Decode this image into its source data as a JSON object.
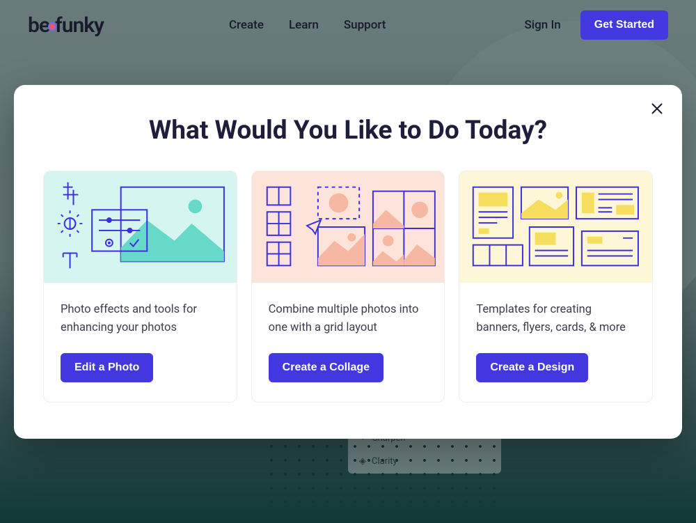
{
  "header": {
    "logo_text_left": "be",
    "logo_text_right": "funky",
    "nav": [
      "Create",
      "Learn",
      "Support"
    ],
    "signin": "Sign In",
    "get_started": "Get Started"
  },
  "bg_panel": {
    "row1": "Sharpen",
    "row2": "Clarity"
  },
  "modal": {
    "title": "What Would You Like to Do Today?",
    "cards": [
      {
        "desc": "Photo effects and tools for enhancing your photos",
        "button": "Edit a Photo"
      },
      {
        "desc": "Combine multiple photos into one with a grid layout",
        "button": "Create a Collage"
      },
      {
        "desc": "Templates for creating banners, flyers, cards, & more",
        "button": "Create a Design"
      }
    ]
  }
}
